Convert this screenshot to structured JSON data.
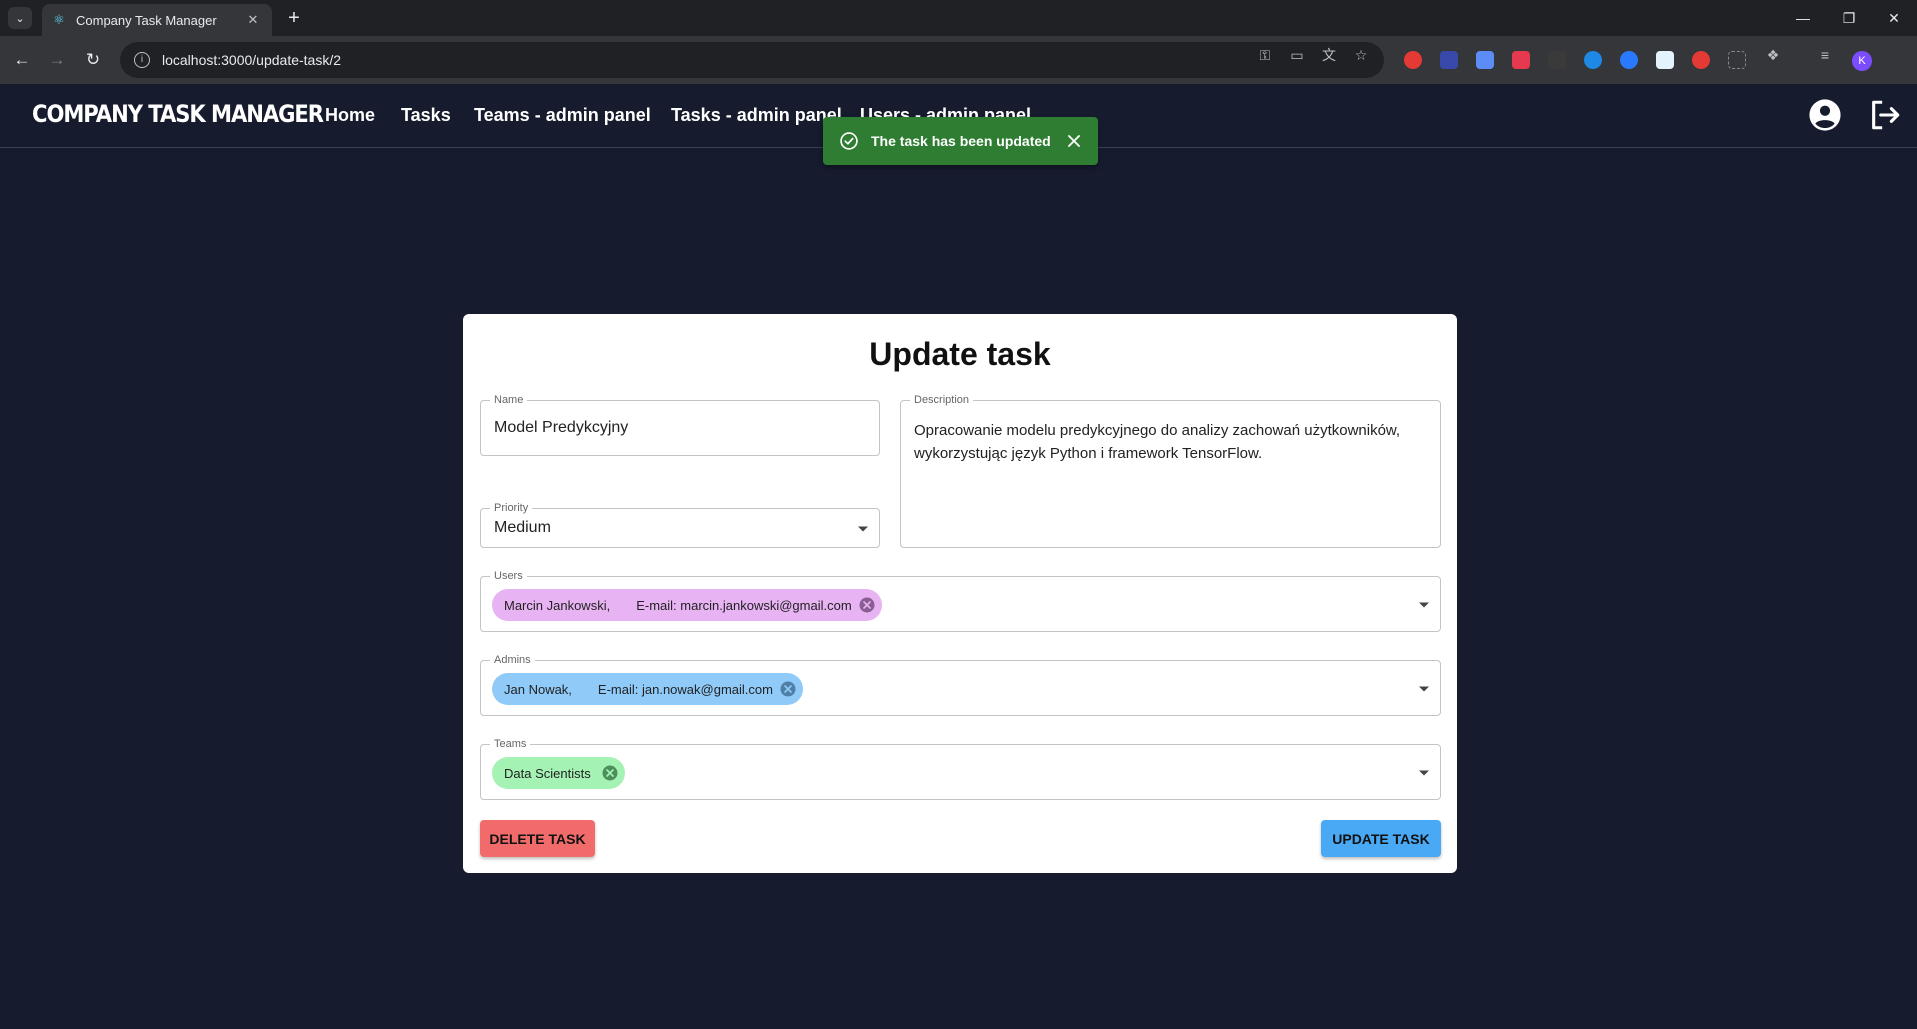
{
  "browser": {
    "tab_title": "Company Task Manager",
    "url": "localhost:3000/update-task/2",
    "profile_initial": "K"
  },
  "app": {
    "brand": "COMPANY TASK MANAGER",
    "nav": [
      "Home",
      "Tasks",
      "Teams - admin panel",
      "Tasks - admin panel",
      "Users - admin panel"
    ]
  },
  "toast": {
    "message": "The task has been updated",
    "color": "#2e7d32"
  },
  "form": {
    "title": "Update task",
    "name": {
      "label": "Name",
      "value": "Model Predykcyjny"
    },
    "description": {
      "label": "Description",
      "value": "Opracowanie modelu predykcyjnego do analizy zachowań użytkowników, wykorzystując język Python i framework TensorFlow."
    },
    "priority": {
      "label": "Priority",
      "value": "Medium"
    },
    "users": {
      "label": "Users",
      "chips": [
        {
          "name": "Marcin Jankowski,",
          "email": "E-mail: marcin.jankowski@gmail.com",
          "color": "#e7b3f3"
        }
      ]
    },
    "admins": {
      "label": "Admins",
      "chips": [
        {
          "name": "Jan Nowak,",
          "email": "E-mail: jan.nowak@gmail.com",
          "color": "#90caf9"
        }
      ]
    },
    "teams": {
      "label": "Teams",
      "chips": [
        {
          "name": "Data Scientists",
          "color": "#a5f3b4"
        }
      ]
    },
    "delete_label": "DELETE TASK",
    "update_label": "UPDATE TASK",
    "delete_color": "#f26b6b",
    "update_color": "#4aa9f5"
  }
}
